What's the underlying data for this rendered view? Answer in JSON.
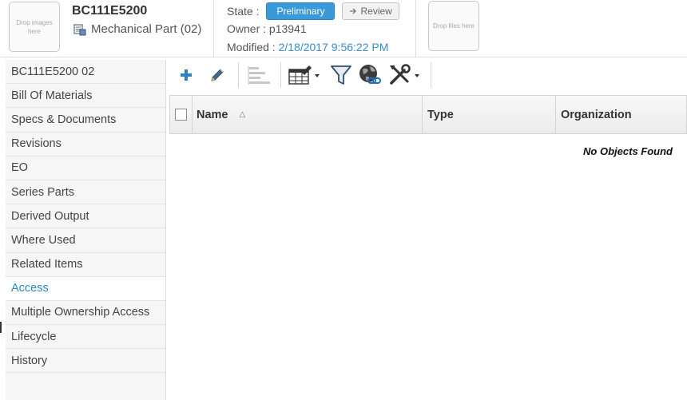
{
  "header": {
    "drop_images_text": "Drop images here",
    "part_number": "BC111E5200",
    "part_type": "Mechanical Part (02)",
    "part_type_icon": "part-icon",
    "state_label": "State :",
    "state_value": "Preliminary",
    "review_label": "Review",
    "review_icon": "arrow-right-icon",
    "owner_label": "Owner :",
    "owner_value": "p13941",
    "modified_label": "Modified :",
    "modified_value": "2/18/2017 9:56:22 PM",
    "drop_files_text": "Drop files here"
  },
  "sidebar": {
    "items": [
      {
        "label": "BC111E5200 02",
        "active": false
      },
      {
        "label": "Bill Of Materials",
        "active": false
      },
      {
        "label": "Specs & Documents",
        "active": false
      },
      {
        "label": "Revisions",
        "active": false
      },
      {
        "label": "EO",
        "active": false
      },
      {
        "label": "Series Parts",
        "active": false
      },
      {
        "label": "Derived Output",
        "active": false
      },
      {
        "label": "Where Used",
        "active": false
      },
      {
        "label": "Related Items",
        "active": false
      },
      {
        "label": "Access",
        "active": true
      },
      {
        "label": "Multiple Ownership Access",
        "active": false
      },
      {
        "label": "Lifecycle",
        "active": false
      },
      {
        "label": "History",
        "active": false
      }
    ]
  },
  "toolbar": {
    "icons": [
      "add-icon",
      "edit-icon",
      "indent-icon",
      "table-edit-icon",
      "filter-icon",
      "global-link-icon",
      "tools-icon"
    ]
  },
  "table": {
    "columns": [
      "Name",
      "Type",
      "Organization"
    ],
    "sort_indicator": "△",
    "empty_message": "No Objects Found"
  },
  "colors": {
    "accent": "#3a9ad9",
    "link": "#2c8ac7",
    "sidebar_bg": "#f6f6f6"
  }
}
